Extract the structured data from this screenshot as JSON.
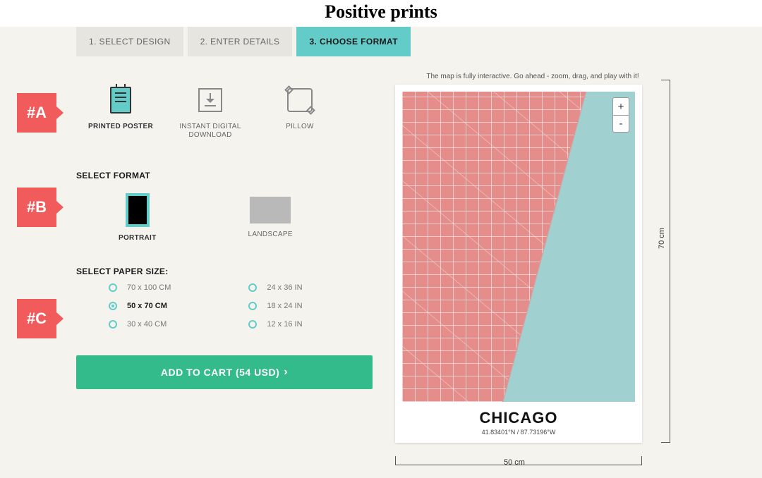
{
  "brand": "Positive prints",
  "tabs": [
    {
      "label": "1. SELECT DESIGN",
      "active": false
    },
    {
      "label": "2. ENTER DETAILS",
      "active": false
    },
    {
      "label": "3. CHOOSE FORMAT",
      "active": true
    }
  ],
  "products": {
    "poster": "PRINTED POSTER",
    "download": "INSTANT DIGITAL DOWNLOAD",
    "pillow": "PILLOW"
  },
  "format": {
    "title": "SELECT FORMAT",
    "portrait": "PORTRAIT",
    "landscape": "LANDSCAPE"
  },
  "size": {
    "title": "SELECT PAPER SIZE:",
    "left": [
      {
        "label": "70 x 100 CM",
        "selected": false
      },
      {
        "label": "50 x 70 CM",
        "selected": true
      },
      {
        "label": "30 x 40 CM",
        "selected": false
      }
    ],
    "right": [
      {
        "label": "24 x 36 IN",
        "selected": false
      },
      {
        "label": "18 x 24 IN",
        "selected": false
      },
      {
        "label": "12 x 16 IN",
        "selected": false
      }
    ]
  },
  "cart_label": "ADD TO CART (54 USD)",
  "preview": {
    "hint": "The map is fully interactive. Go ahead - zoom, drag, and play with it!",
    "title": "CHICAGO",
    "subtitle": "41.83401°N / 87.73196°W",
    "dim_h": "70 cm",
    "dim_w": "50 cm",
    "zoom_in": "+",
    "zoom_out": "-"
  },
  "annotations": {
    "a": "#A",
    "b": "#B",
    "c": "#C"
  }
}
